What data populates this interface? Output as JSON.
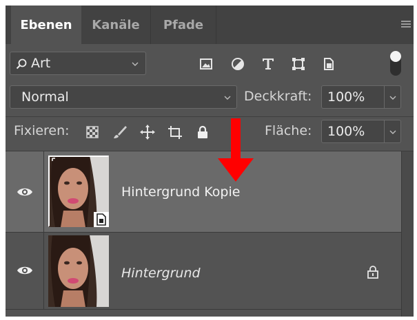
{
  "tabs": [
    {
      "label": "Ebenen",
      "active": true
    },
    {
      "label": "Kanäle",
      "active": false
    },
    {
      "label": "Pfade",
      "active": false
    }
  ],
  "panel_menu_icon": "hamburger-menu-icon",
  "filter": {
    "kind_label": "Art",
    "icons": [
      "pixel-layer-filter-icon",
      "adjustment-layer-filter-icon",
      "type-layer-filter-icon",
      "shape-layer-filter-icon",
      "smart-object-filter-icon"
    ],
    "toggle_state": "on"
  },
  "blend_mode": {
    "value": "Normal"
  },
  "opacity": {
    "label": "Deckkraft:",
    "value": "100%"
  },
  "lock": {
    "label": "Fixieren:",
    "icons": [
      "lock-transparent-pixels-icon",
      "lock-image-pixels-icon",
      "lock-position-icon",
      "lock-artboard-icon",
      "lock-all-icon"
    ]
  },
  "fill": {
    "label": "Fläche:",
    "value": "100%"
  },
  "layers": [
    {
      "name": "Hintergrund Kopie",
      "visible": true,
      "selected": true,
      "smart_object": true,
      "locked": false
    },
    {
      "name": "Hintergrund",
      "visible": true,
      "selected": false,
      "smart_object": false,
      "locked": true
    }
  ],
  "annotation": {
    "type": "red-down-arrow",
    "color": "#ff0000"
  },
  "colors": {
    "panel": "#535353",
    "tabbar": "#424242",
    "selected_layer": "#6a6a6a",
    "field": "#454545"
  }
}
